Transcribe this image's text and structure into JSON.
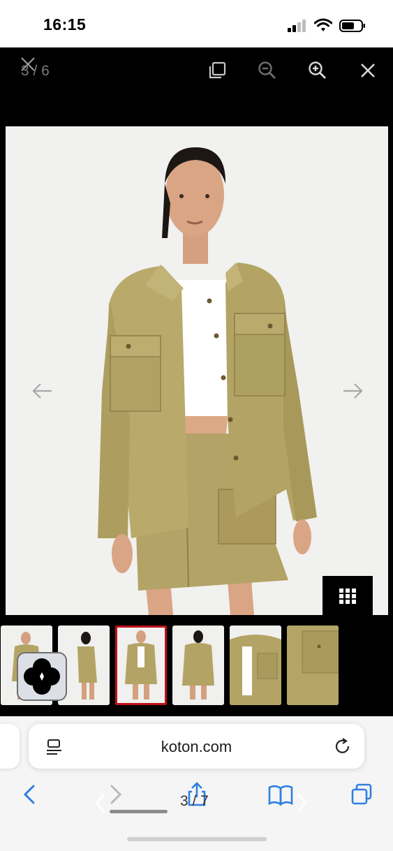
{
  "status_bar": {
    "time": "16:15"
  },
  "viewer": {
    "counter": "3 / 6",
    "toolbar_icons": [
      "copy-icon",
      "zoom-out-icon",
      "zoom-in-icon",
      "close-icon"
    ],
    "colors": {
      "background": "#000000",
      "selected_thumb_border": "#c0101a"
    }
  },
  "thumbnails": {
    "count": 7,
    "selected_index": 2
  },
  "browser": {
    "url": "koton.com",
    "page_indicator": "3 / 7",
    "toolbar_icons": [
      "back-icon",
      "forward-icon",
      "share-icon",
      "bookmarks-icon",
      "tabs-icon"
    ],
    "accent_color": "#2f7fe0"
  }
}
